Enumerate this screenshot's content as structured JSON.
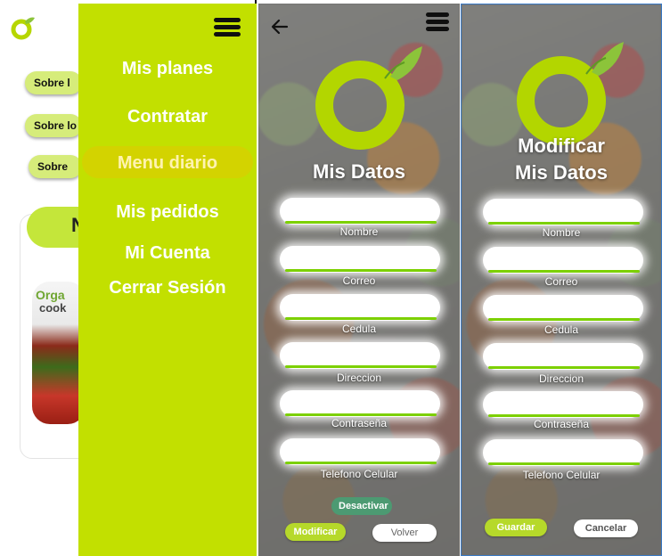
{
  "home": {
    "pills": [
      "Sobre l",
      "Sobre lo",
      "Sobre"
    ],
    "banner_text": "N",
    "card_label_1": "Orga",
    "card_label_2": "cook"
  },
  "drawer": {
    "items": [
      {
        "label": "Mis planes",
        "active": false
      },
      {
        "label": "Contratar",
        "active": false
      },
      {
        "label": "Menu diario",
        "active": true
      },
      {
        "label": "Mis pedidos",
        "active": false
      },
      {
        "label": "Mi Cuenta",
        "active": false
      },
      {
        "label": "Cerrar Sesión",
        "active": false
      }
    ]
  },
  "mis_datos": {
    "title": "Mis Datos",
    "fields": [
      {
        "label": "Nombre",
        "value": ""
      },
      {
        "label": "Correo",
        "value": ""
      },
      {
        "label": "Cedula",
        "value": ""
      },
      {
        "label": "Direccion",
        "value": ""
      },
      {
        "label": "Contraseña",
        "value": ""
      },
      {
        "label": "Telefono Celular",
        "value": ""
      }
    ],
    "deactivate_label": "Desactivar",
    "modify_label": "Modificar",
    "back_label": "Volver"
  },
  "modificar": {
    "title_line1": "Modificar",
    "title_line2": "Mis Datos",
    "fields": [
      {
        "label": "Nombre",
        "value": ""
      },
      {
        "label": "Correo",
        "value": ""
      },
      {
        "label": "Cedula",
        "value": ""
      },
      {
        "label": "Direccion",
        "value": ""
      },
      {
        "label": "Contraseña",
        "value": ""
      },
      {
        "label": "Telefono Celular",
        "value": ""
      }
    ],
    "save_label": "Guardar",
    "cancel_label": "Cancelar"
  },
  "colors": {
    "brand_green": "#c2e000",
    "field_underline": "#7cd000",
    "button_green": "#b6d92a",
    "deactivate_teal": "#4c9a72"
  },
  "icons": [
    "logo-icon",
    "menu-icon",
    "back-arrow-icon"
  ]
}
